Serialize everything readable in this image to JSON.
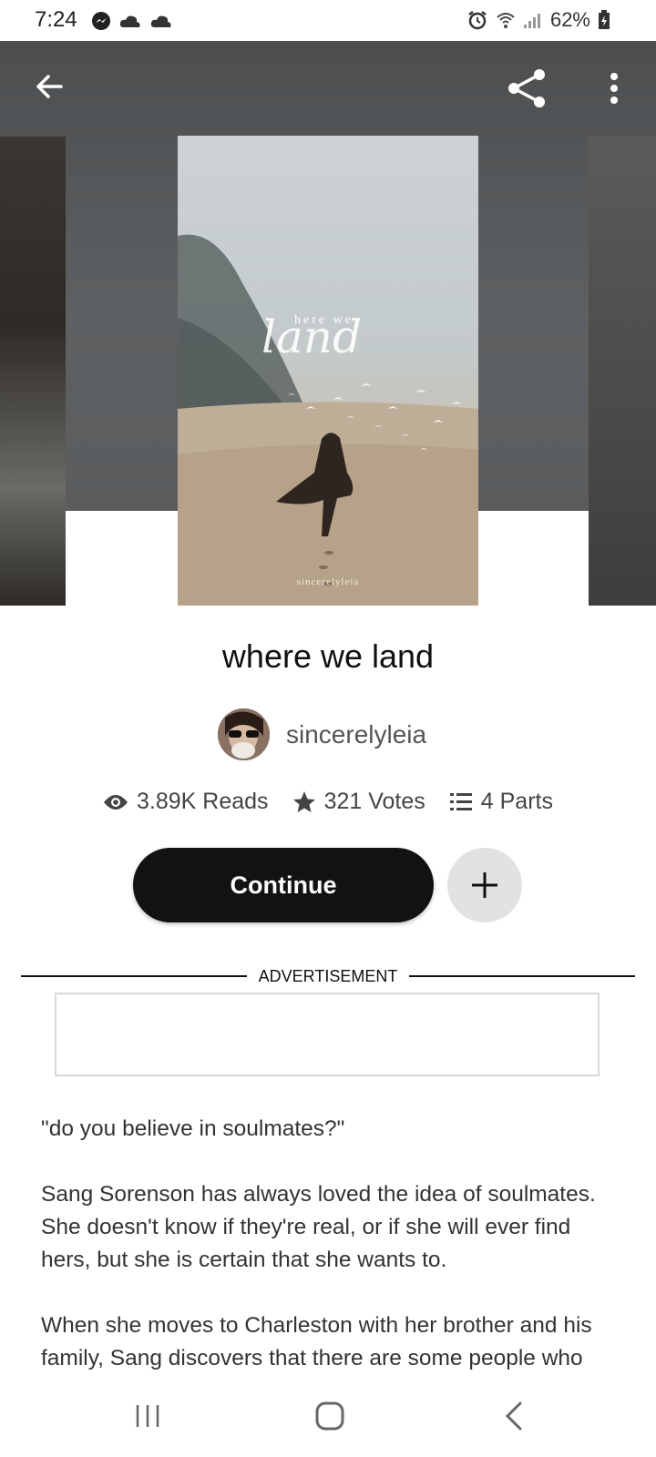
{
  "status_bar": {
    "time": "7:24",
    "battery": "62%"
  },
  "header": {
    "back_icon": "arrow-left-icon",
    "share_icon": "share-icon",
    "more_icon": "more-vertical-icon"
  },
  "cover": {
    "title_small": "here we",
    "title_script": "land",
    "author_credit": "sincerelyleia"
  },
  "story": {
    "title": "where we land",
    "author": "sincerelyleia",
    "stats": {
      "reads": "3.89K Reads",
      "votes": "321 Votes",
      "parts": "4 Parts"
    },
    "continue_label": "Continue"
  },
  "advertisement": {
    "label": "ADVERTISEMENT"
  },
  "description": {
    "paragraphs": [
      "\"do you believe in soulmates?\"",
      "Sang Sorenson has always loved the idea of soulmates. She doesn't know if they're real, or if she will ever find hers, but she is certain that she wants to.",
      "When she moves to Charleston with her brother and his family, Sang discovers that there are some people who"
    ]
  },
  "nav_bar": {
    "items": [
      "recents-icon",
      "home-icon",
      "back-icon"
    ]
  },
  "colors": {
    "button_dark": "#121212",
    "add_button_bg": "#e2e2e2",
    "header_bg": "#4c4e50"
  }
}
